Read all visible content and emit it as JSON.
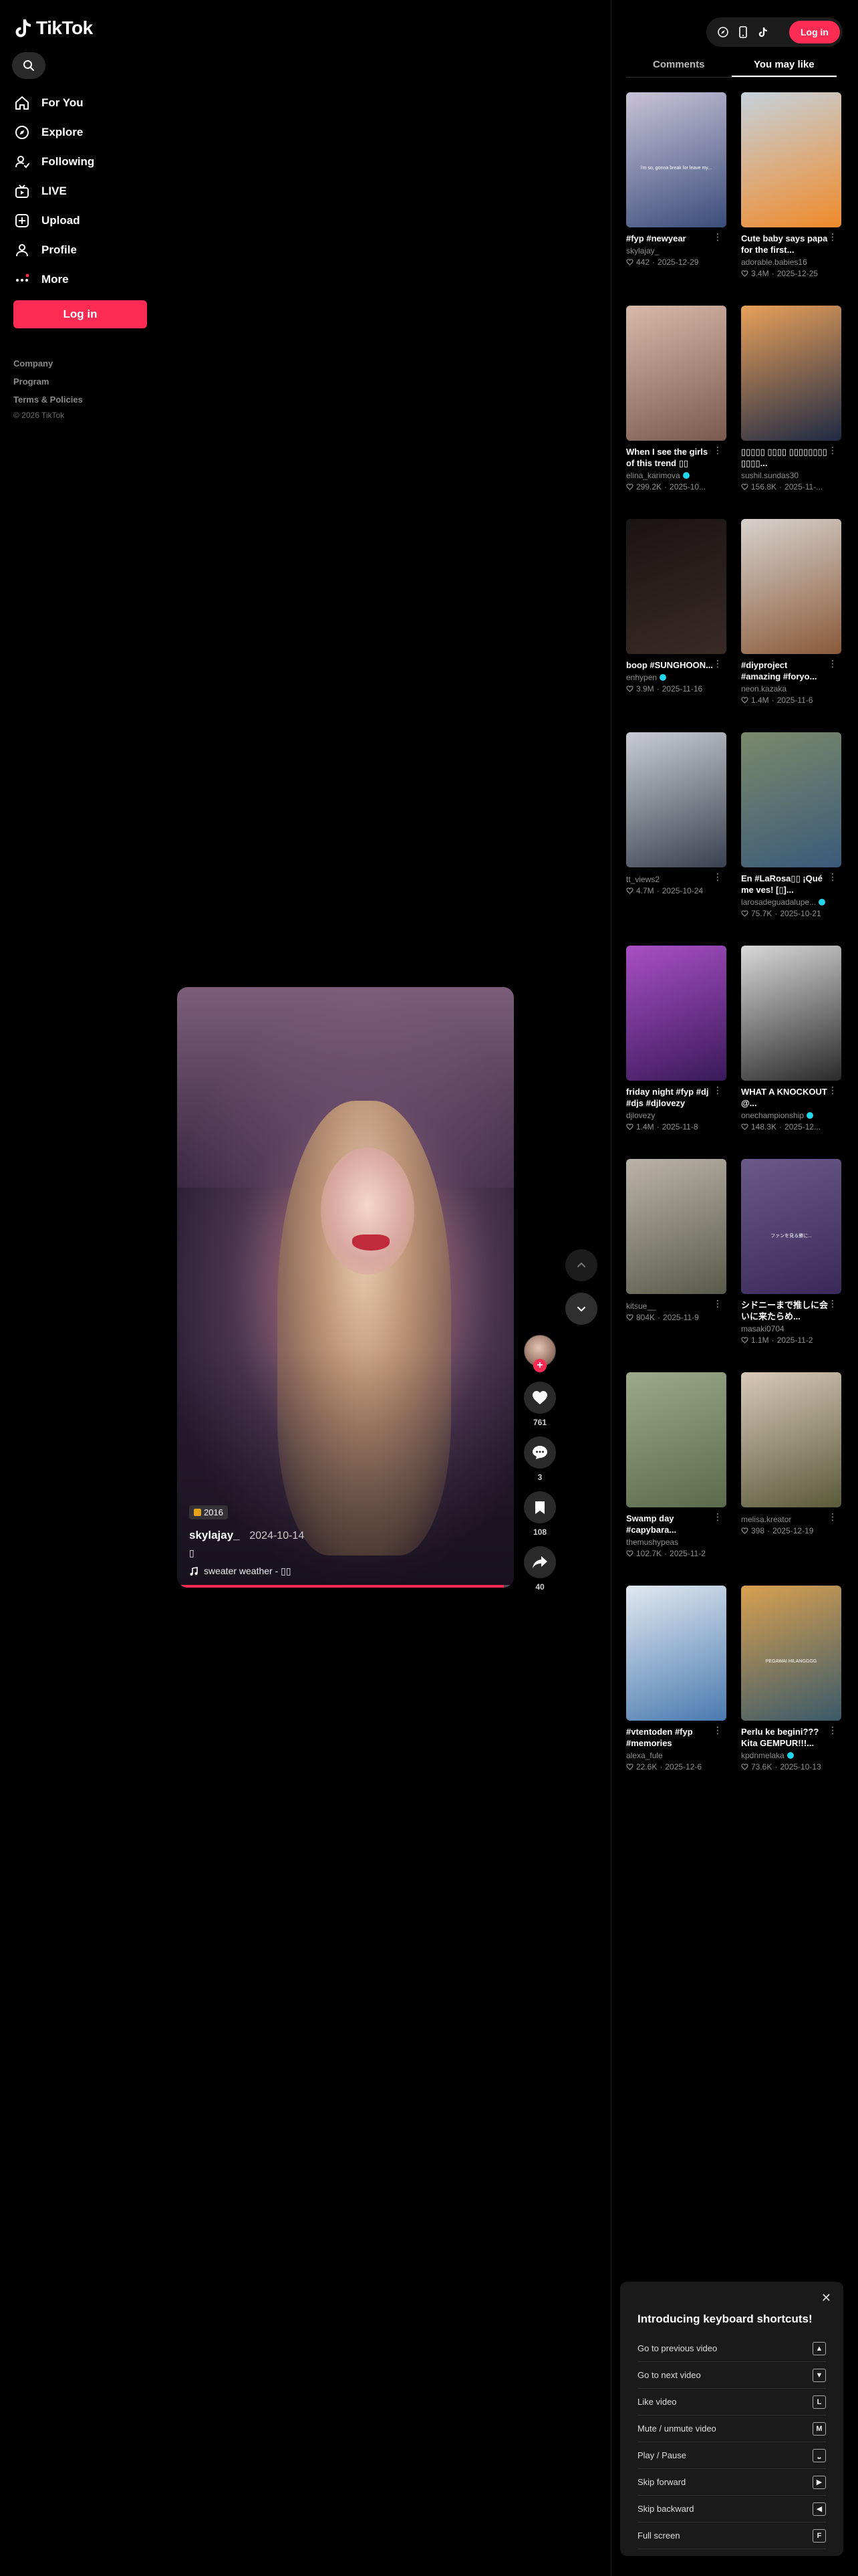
{
  "brand": {
    "name": "TikTok",
    "accent": "#fe2c55"
  },
  "sidebar": {
    "items": [
      {
        "label": "For You",
        "icon": "home-icon"
      },
      {
        "label": "Explore",
        "icon": "compass-icon"
      },
      {
        "label": "Following",
        "icon": "following-icon"
      },
      {
        "label": "LIVE",
        "icon": "live-icon"
      },
      {
        "label": "Upload",
        "icon": "upload-icon"
      },
      {
        "label": "Profile",
        "icon": "profile-icon"
      },
      {
        "label": "More",
        "icon": "more-icon"
      }
    ],
    "login_label": "Log in",
    "footer": {
      "company": "Company",
      "program": "Program",
      "terms": "Terms & Policies",
      "copyright": "© 2026 TikTok"
    }
  },
  "video": {
    "sticker": "2016",
    "username": "skylajay_",
    "date": "2024-10-14",
    "description": "▯",
    "music": "sweater weather - ▯▯",
    "progress": 0.97,
    "likes": "761",
    "comments": "3",
    "saves": "108",
    "shares": "40"
  },
  "header": {
    "login_label": "Log in"
  },
  "tabs": {
    "comments": "Comments",
    "you_may_like": "You may like"
  },
  "recommendations": [
    {
      "title": "#fyp #newyear",
      "author": "skylajay_",
      "verified": false,
      "likes": "442",
      "date": "2025-12-29",
      "c1": "#3a4d7a",
      "c2": "#c9c2d8",
      "overlay": "i'm so, gonna break for leave my..."
    },
    {
      "title": "Cute baby says papa for the first...",
      "author": "adorable.babies16",
      "verified": false,
      "likes": "3.4M",
      "date": "2025-12-25",
      "c1": "#f08a2a",
      "c2": "#c5d2dc",
      "overlay": ""
    },
    {
      "title": "When I see the girls of this trend ▯▯",
      "author": "elina_karimova",
      "verified": true,
      "likes": "299.2K",
      "date": "2025-10...",
      "c1": "#7a5a4f",
      "c2": "#d8b8a8",
      "overlay": ""
    },
    {
      "title": "▯▯▯▯▯ ▯▯▯▯ ▯▯▯▯▯▯▯▯ ▯▯▯▯...",
      "author": "sushil.sundas30",
      "verified": false,
      "likes": "156.8K",
      "date": "2025-11-...",
      "c1": "#1f2a44",
      "c2": "#e8a05a",
      "overlay": ""
    },
    {
      "title": "boop #SUNGHOON...",
      "author": "enhypen",
      "verified": true,
      "likes": "3.9M",
      "date": "2025-11-16",
      "c1": "#3a2a26",
      "c2": "#1a1414",
      "overlay": ""
    },
    {
      "title": "#diyproject #amazing #foryo...",
      "author": "neon.kazaka",
      "verified": false,
      "likes": "1.4M",
      "date": "2025-11-6",
      "c1": "#8a5a3a",
      "c2": "#d7d2cc",
      "overlay": ""
    },
    {
      "title": "",
      "author": "tt_views2",
      "verified": false,
      "likes": "4.7M",
      "date": "2025-10-24",
      "c1": "#3a4150",
      "c2": "#c9ccd2",
      "overlay": ""
    },
    {
      "title": "En #LaRosa▯▯ ¡Qué me ves! [▯]...",
      "author": "larosadeguadalupe...",
      "verified": true,
      "likes": "75.7K",
      "date": "2025-10-21",
      "c1": "#3b5a7a",
      "c2": "#7a8a6a",
      "overlay": ""
    },
    {
      "title": "friday night #fyp #dj #djs #djlovezy",
      "author": "djlovezy",
      "verified": false,
      "likes": "1.4M",
      "date": "2025-11-8",
      "c1": "#3a1a5a",
      "c2": "#a84fc4",
      "overlay": ""
    },
    {
      "title": "WHAT A KNOCKOUT @...",
      "author": "onechampionship",
      "verified": true,
      "likes": "148.3K",
      "date": "2025-12...",
      "c1": "#2a2a2a",
      "c2": "#d8d8d8",
      "overlay": ""
    },
    {
      "title": "",
      "author": "kitsue__",
      "verified": false,
      "likes": "804K",
      "date": "2025-11-9",
      "c1": "#5a5a4a",
      "c2": "#b9b4a8",
      "overlay": ""
    },
    {
      "title": "シドニーまで推しに会いに来たらめ...",
      "author": "masaki0704",
      "verified": false,
      "likes": "1.1M",
      "date": "2025-11-2",
      "c1": "#3a2a5a",
      "c2": "#6a5a8a",
      "overlay": "ファンを見る勝に..."
    },
    {
      "title": "Swamp day #capybara...",
      "author": "themushypeas",
      "verified": false,
      "likes": "102.7K",
      "date": "2025-11-2",
      "c1": "#5a6a4a",
      "c2": "#9aaa8a",
      "overlay": ""
    },
    {
      "title": "",
      "author": "melisa.kreator",
      "verified": false,
      "likes": "398",
      "date": "2025-12-19",
      "c1": "#5a5a3a",
      "c2": "#d8c8b8",
      "overlay": ""
    },
    {
      "title": "#vtentoden #fyp #memories",
      "author": "alexa_fule",
      "verified": false,
      "likes": "22.6K",
      "date": "2025-12-6",
      "c1": "#4a7ab0",
      "c2": "#e0e8f0",
      "overlay": ""
    },
    {
      "title": "Perlu ke begini??? Kita GEMPUR!!!...",
      "author": "kpdnmelaka",
      "verified": true,
      "likes": "73.6K",
      "date": "2025-10-13",
      "c1": "#3a5a6a",
      "c2": "#d8a050",
      "overlay": "PEGAWAI HILANGGGG"
    }
  ],
  "shortcuts": {
    "title": "Introducing keyboard shortcuts!",
    "items": [
      {
        "label": "Go to previous video",
        "key": "▲"
      },
      {
        "label": "Go to next video",
        "key": "▼"
      },
      {
        "label": "Like video",
        "key": "L"
      },
      {
        "label": "Mute / unmute video",
        "key": "M"
      },
      {
        "label": "Play / Pause",
        "key": "⎵"
      },
      {
        "label": "Skip forward",
        "key": "▶"
      },
      {
        "label": "Skip backward",
        "key": "◀"
      },
      {
        "label": "Full screen",
        "key": "F"
      }
    ]
  }
}
